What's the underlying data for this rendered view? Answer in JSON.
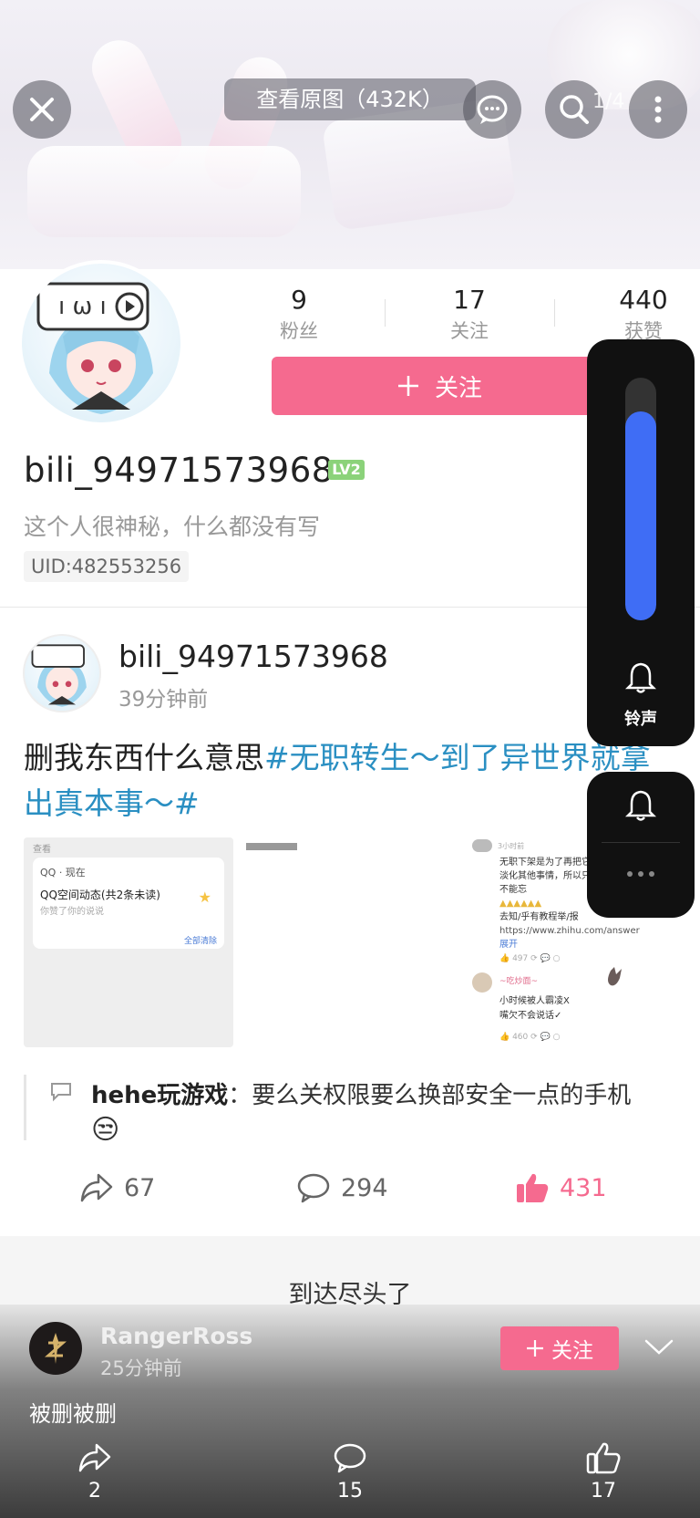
{
  "top_bar": {
    "view_original": "查看原图（432K）",
    "page_indicator": "1/4"
  },
  "profile": {
    "stats": [
      {
        "value": "9",
        "label": "粉丝"
      },
      {
        "value": "17",
        "label": "关注"
      },
      {
        "value": "440",
        "label": "获赞"
      }
    ],
    "follow_label": "关注",
    "username": "bili_94971573968",
    "level": "LV2",
    "bio": "这个人很神秘，什么都没有写",
    "uid": "UID:482553256"
  },
  "post": {
    "username": "bili_94971573968",
    "time": "39分钟前",
    "text_plain": "删我东西什么意思",
    "text_tag": "#无职转生～到了异世界就拿出真本事～#",
    "thumb1": {
      "header": "查看",
      "app": "QQ · 现在",
      "title": "QQ空间动态(共2条未读)",
      "sub": "你赞了你的说说",
      "clear": "全部清除"
    },
    "thumb3": {
      "time": "3小时前",
      "line1": "无职下架是为了再把它",
      "line2": "淡化其他事情，所以只",
      "line3": "不能忘",
      "line4": "去知/乎有教程举/报",
      "url": "https://www.zhihu.com/answer",
      "expand": "展开",
      "likes1": "497",
      "user2": "~吃炒面~",
      "reply1": "小时候被人霸凌X",
      "reply2": "嘴欠不会说话✓",
      "likes2": "460"
    },
    "comment_user": "hehe玩游戏",
    "comment_text": "：要么关权限要么换部安全一点的手机",
    "comment_emoji": "😒",
    "shares": "67",
    "comments": "294",
    "likes": "431"
  },
  "end_text": "到达尽头了",
  "bottom": {
    "username": "RangerRoss",
    "time": "25分钟前",
    "follow_label": "关注",
    "text": "被删被删",
    "shares": "2",
    "comments": "15",
    "likes": "17"
  },
  "volume": {
    "level": 0.86,
    "label": "铃声"
  },
  "colors": {
    "accent_pink": "#f56a8f",
    "link_blue": "#2a8fc2",
    "volume_blue": "#3f6df5"
  }
}
